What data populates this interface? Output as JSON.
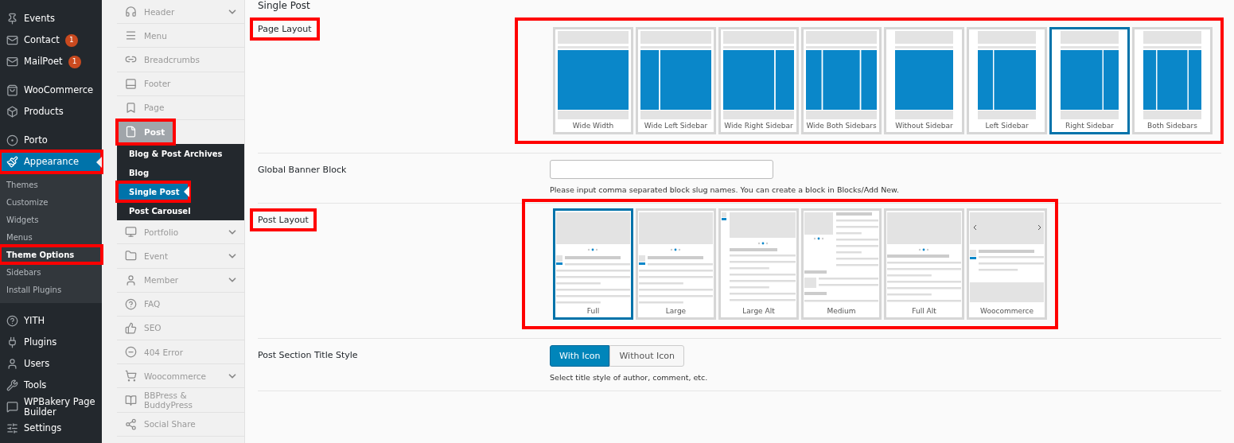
{
  "admin_menu": {
    "groups": [
      [
        {
          "label": "Events",
          "selected": false,
          "highlighted": false
        },
        {
          "label": "Contact",
          "badge": "1",
          "selected": false,
          "highlighted": false
        },
        {
          "label": "MailPoet",
          "badge": "1",
          "selected": false,
          "highlighted": false
        }
      ],
      [
        {
          "label": "WooCommerce",
          "selected": false,
          "highlighted": false
        },
        {
          "label": "Products",
          "selected": false,
          "highlighted": false
        }
      ],
      [
        {
          "label": "Porto",
          "selected": false,
          "highlighted": false
        },
        {
          "label": "Appearance",
          "selected": true,
          "highlighted": true,
          "children": [
            {
              "label": "Themes",
              "selected": false,
              "highlighted": false
            },
            {
              "label": "Customize",
              "selected": false,
              "highlighted": false
            },
            {
              "label": "Widgets",
              "selected": false,
              "highlighted": false
            },
            {
              "label": "Menus",
              "selected": false,
              "highlighted": false
            },
            {
              "label": "Theme Options",
              "selected": true,
              "highlighted": true
            },
            {
              "label": "Sidebars",
              "selected": false,
              "highlighted": false
            },
            {
              "label": "Install Plugins",
              "selected": false,
              "highlighted": false
            }
          ]
        }
      ],
      [
        {
          "label": "YITH",
          "selected": false,
          "highlighted": false
        },
        {
          "label": "Plugins",
          "selected": false,
          "highlighted": false
        },
        {
          "label": "Users",
          "selected": false,
          "highlighted": false
        },
        {
          "label": "Tools",
          "selected": false,
          "highlighted": false
        },
        {
          "label": "WPBakery Page Builder",
          "selected": false,
          "highlighted": false
        },
        {
          "label": "Settings",
          "selected": false,
          "highlighted": false
        }
      ]
    ]
  },
  "options_menu": {
    "items": [
      {
        "label": "Header",
        "expandable": true,
        "selected": false,
        "highlighted": false
      },
      {
        "label": "Menu",
        "expandable": false,
        "selected": false,
        "highlighted": false
      },
      {
        "label": "Breadcrumbs",
        "expandable": false,
        "selected": false,
        "highlighted": false
      },
      {
        "label": "Footer",
        "expandable": false,
        "selected": false,
        "highlighted": false
      },
      {
        "label": "Page",
        "expandable": false,
        "selected": false,
        "highlighted": false
      },
      {
        "label": "Post",
        "expandable": false,
        "selected": true,
        "highlighted": true,
        "children": [
          {
            "label": "Blog & Post Archives",
            "selected": false,
            "highlighted": false
          },
          {
            "label": "Blog",
            "selected": false,
            "highlighted": false
          },
          {
            "label": "Single Post",
            "selected": true,
            "highlighted": true
          },
          {
            "label": "Post Carousel",
            "selected": false,
            "highlighted": false
          }
        ]
      },
      {
        "label": "Portfolio",
        "expandable": true,
        "selected": false,
        "highlighted": false
      },
      {
        "label": "Event",
        "expandable": true,
        "selected": false,
        "highlighted": false
      },
      {
        "label": "Member",
        "expandable": true,
        "selected": false,
        "highlighted": false
      },
      {
        "label": "FAQ",
        "expandable": false,
        "selected": false,
        "highlighted": false
      },
      {
        "label": "SEO",
        "expandable": false,
        "selected": false,
        "highlighted": false
      },
      {
        "label": "404 Error",
        "expandable": false,
        "selected": false,
        "highlighted": false
      },
      {
        "label": "Woocommerce",
        "expandable": true,
        "selected": false,
        "highlighted": false
      },
      {
        "label": "BBPress & BuddyPress",
        "expandable": false,
        "selected": false,
        "highlighted": false
      },
      {
        "label": "Social Share",
        "expandable": false,
        "selected": false,
        "highlighted": false
      }
    ]
  },
  "section_title": "Single Post",
  "fields": [
    {
      "kind": "image_select",
      "label": "Page Layout",
      "highlighted": true,
      "options": [
        {
          "kind": "wide-full",
          "label": "Wide Width",
          "selected": false
        },
        {
          "kind": "wide-left",
          "label": "Wide Left Sidebar",
          "selected": false
        },
        {
          "kind": "wide-right",
          "label": "Wide Right Sidebar",
          "selected": false
        },
        {
          "kind": "wide-both",
          "label": "Wide Both Sidebars",
          "selected": false
        },
        {
          "kind": "full",
          "label": "Without Sidebar",
          "selected": false
        },
        {
          "kind": "left",
          "label": "Left Sidebar",
          "selected": false
        },
        {
          "kind": "right",
          "label": "Right Sidebar",
          "selected": true
        },
        {
          "kind": "both",
          "label": "Both Sidebars",
          "selected": false
        }
      ]
    },
    {
      "kind": "text",
      "label": "Global Banner Block",
      "highlighted": false,
      "help": "Please input comma separated block slug names. You can create a block in Blocks/Add New."
    },
    {
      "kind": "post_select",
      "label": "Post Layout",
      "highlighted": true,
      "options": [
        {
          "kind": "full",
          "label": "Full",
          "selected": true
        },
        {
          "kind": "large",
          "label": "Large",
          "selected": false
        },
        {
          "kind": "large-alt",
          "label": "Large Alt",
          "selected": false
        },
        {
          "kind": "medium",
          "label": "Medium",
          "selected": false
        },
        {
          "kind": "full-alt",
          "label": "Full Alt",
          "selected": false
        },
        {
          "kind": "woocommerce",
          "label": "Woocommerce",
          "selected": false
        }
      ]
    },
    {
      "kind": "buttons",
      "label": "Post Section Title Style",
      "highlighted": false,
      "options": [
        {
          "label": "With Icon",
          "selected": true
        },
        {
          "label": "Without Icon",
          "selected": false
        }
      ],
      "help": "Select title style of author, comment, etc."
    }
  ]
}
